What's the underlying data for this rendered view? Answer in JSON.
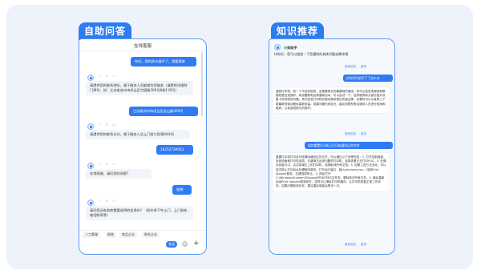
{
  "left_tab": "自助问答",
  "right_tab": "知识推荐",
  "chat": {
    "title": "在线客服",
    "messages": [
      {
        "role": "user",
        "text": "你好，我的热水器坏了，我要报修"
      },
      {
        "role": "bot",
        "text": "请提供您的联系地址，便于服务人员能够为您服务（请提供详细到门牌号，如：江苏省苏州市虎丘区竹园路309号8栋130号）"
      },
      {
        "role": "user",
        "text": "江苏省苏州市虎丘区金山路309号"
      },
      {
        "role": "bot",
        "text": "请提供您的联系方式，便于服务人员上门前与您预约时间"
      },
      {
        "role": "user",
        "text": "18252739953"
      },
      {
        "role": "bot",
        "text": "非常感谢，请问您时间呢?"
      },
      {
        "role": "user",
        "text": "星期"
      },
      {
        "role": "bot",
        "text": "请问您还有其他需要说明的信息吗？（如冬季下午上门、上门前先电话联系等）"
      }
    ],
    "msg_icons": "✓ ✗ ☐",
    "quick_buttons": [
      "人工客服",
      "报修",
      "商品企业",
      "联系企业"
    ],
    "input_placeholder": "",
    "send_label": "发送",
    "emoji_glyph": "☺",
    "plus_glyph": "+"
  },
  "kb": {
    "bot_name": "小知助手",
    "intro": "Hi你好，您可以描述一下您遇到的具体问题或需求哦",
    "actions_1": [
      "复制回答",
      "重排"
    ],
    "user_q1": "好的打印机不了了怎么办",
    "answer_1": "遇到打印机，而一个不容忽视的，这是最常见的最基础的原因，你可以检查电源线和数据线是否连接好，将设备断电后再重新启动，可以尝试一下，这样能排除大部分因为设备卡死导致的问题。其次检查打印机的驱动程序是否安装正确，必要时可以从官网上下载最新的驱动程序重新安装。如果问题仍然存在，建议您联系售后服务人员进行检测和维修，以免造成更大的损坏。",
    "actions_2": [
      "复制回答",
      "重排"
    ],
    "user_q2": "如何重置打印机已打印机缓存区的文件",
    "answer_2": "重置打印机打印队列或清除缓存区的文件，可以通过以下步骤完成：1. 打开控制面板，找到设备和打印机选项，右键单击出现问题的打印机，选择查看正在打印什么。2. 在弹出的窗口中，点击菜单栏上的打印机，选择取消所有文档。3. 如果上述方法无效，可以尝试停止打印后台处理程序服务，打开运行窗口，输入services.msc，找到Print Spooler服务，右键选择停止。4. 然后打开C:\\Windows\\System32\\spool\\PRINTERS文件夹，删除其中所有文件。5. 最后重新启动Print Spooler服务即可。这样可以清除打印机缓存，让打印机恢复正常工作状态，如果问题依然存在，建议重启电脑后再试一次。",
    "actions_3": [
      "复制回答",
      "重排"
    ]
  }
}
